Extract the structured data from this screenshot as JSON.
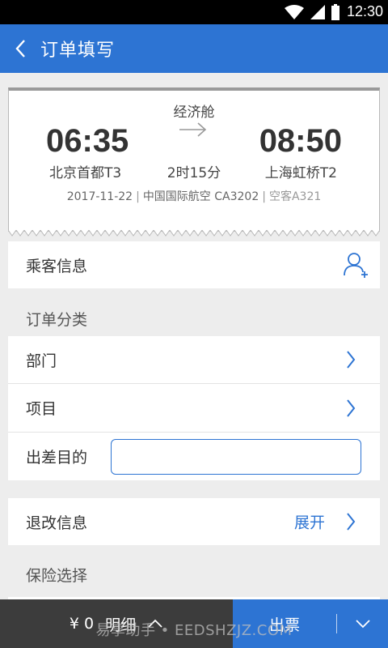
{
  "status_bar": {
    "time": "12:30"
  },
  "header": {
    "title": "订单填写"
  },
  "flight": {
    "cabin": "经济舱",
    "departure_time": "06:35",
    "arrival_time": "08:50",
    "departure_airport": "北京首都T3",
    "arrival_airport": "上海虹桥T2",
    "duration": "2时15分",
    "date": "2017-11-22",
    "airline": "中国国际航空 CA3202",
    "aircraft": "空客A321"
  },
  "passenger": {
    "label": "乘客信息"
  },
  "order_category": {
    "section_label": "订单分类",
    "department_label": "部门",
    "project_label": "项目",
    "purpose_label": "出差目的",
    "purpose_value": ""
  },
  "change_info": {
    "label": "退改信息",
    "expand_label": "展开"
  },
  "insurance": {
    "section_label": "保险选择"
  },
  "bottom": {
    "price": "¥ 0",
    "detail_label": "明细",
    "issue_label": "出票"
  },
  "watermark": "易享助手 • EEDSHZJZ.COM",
  "colors": {
    "primary": "#2d74d3",
    "bottom_dark": "#3c3c3c",
    "background": "#ededed"
  }
}
